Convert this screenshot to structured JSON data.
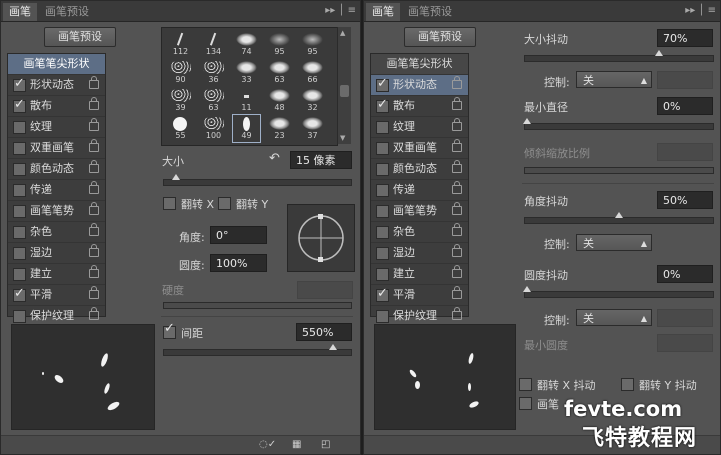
{
  "left": {
    "tabs": [
      "画笔",
      "画笔预设"
    ],
    "panel_menu_icon": "double-chevron-menu",
    "preset_button": "画笔预设",
    "list_header": "画笔笔尖形状",
    "items": [
      {
        "label": "形状动态",
        "checked": true
      },
      {
        "label": "散布",
        "checked": true
      },
      {
        "label": "纹理",
        "checked": false
      },
      {
        "label": "双重画笔",
        "checked": false
      },
      {
        "label": "颜色动态",
        "checked": false
      },
      {
        "label": "传递",
        "checked": false
      },
      {
        "label": "画笔笔势",
        "checked": false
      },
      {
        "label": "杂色",
        "checked": false
      },
      {
        "label": "湿边",
        "checked": false
      },
      {
        "label": "建立",
        "checked": false
      },
      {
        "label": "平滑",
        "checked": true
      },
      {
        "label": "保护纹理",
        "checked": false
      }
    ],
    "tips": [
      {
        "num": "112",
        "shape": "stroke"
      },
      {
        "num": "134",
        "shape": "stroke"
      },
      {
        "num": "74",
        "shape": "splat"
      },
      {
        "num": "95",
        "shape": "soft"
      },
      {
        "num": "95",
        "shape": "soft"
      },
      {
        "num": "90",
        "shape": "grain"
      },
      {
        "num": "36",
        "shape": "grain"
      },
      {
        "num": "33",
        "shape": "splat"
      },
      {
        "num": "63",
        "shape": "splat"
      },
      {
        "num": "66",
        "shape": "splat"
      },
      {
        "num": "39",
        "shape": "grain"
      },
      {
        "num": "63",
        "shape": "grain"
      },
      {
        "num": "11",
        "shape": "dash"
      },
      {
        "num": "48",
        "shape": "splat"
      },
      {
        "num": "32",
        "shape": "splat"
      },
      {
        "num": "55",
        "shape": "circle"
      },
      {
        "num": "100",
        "shape": "grain"
      },
      {
        "num": "49",
        "shape": "ellipse"
      },
      {
        "num": "23",
        "shape": "splat"
      },
      {
        "num": "37",
        "shape": "splat"
      }
    ],
    "size_label": "大小",
    "size_value": "15 像素",
    "flip_x": "翻转 X",
    "flip_y": "翻转 Y",
    "angle_label": "角度:",
    "angle_value": "0°",
    "roundness_label": "圆度:",
    "roundness_value": "100%",
    "hardness_label": "硬度",
    "spacing_label": "间距",
    "spacing_value": "550%",
    "spacing_checked": true
  },
  "right": {
    "tabs": [
      "画笔",
      "画笔预设"
    ],
    "preset_button": "画笔预设",
    "list_header": "画笔笔尖形状",
    "items": [
      {
        "label": "形状动态",
        "checked": true
      },
      {
        "label": "散布",
        "checked": true
      },
      {
        "label": "纹理",
        "checked": false
      },
      {
        "label": "双重画笔",
        "checked": false
      },
      {
        "label": "颜色动态",
        "checked": false
      },
      {
        "label": "传递",
        "checked": false
      },
      {
        "label": "画笔笔势",
        "checked": false
      },
      {
        "label": "杂色",
        "checked": false
      },
      {
        "label": "湿边",
        "checked": false
      },
      {
        "label": "建立",
        "checked": false
      },
      {
        "label": "平滑",
        "checked": true
      },
      {
        "label": "保护纹理",
        "checked": false
      }
    ],
    "size_jitter_label": "大小抖动",
    "size_jitter_value": "70%",
    "control_label": "控制:",
    "control_value": "关",
    "min_diameter_label": "最小直径",
    "min_diameter_value": "0%",
    "tilt_scale_label": "倾斜缩放比例",
    "angle_jitter_label": "角度抖动",
    "angle_jitter_value": "50%",
    "roundness_jitter_label": "圆度抖动",
    "roundness_jitter_value": "0%",
    "min_roundness_label": "最小圆度",
    "flip_x_jitter": "翻转 X 抖动",
    "flip_y_jitter": "翻转 Y 抖动",
    "brush_projection": "画笔"
  },
  "watermark": {
    "line1": "fevte.com",
    "line2": "飞特教程网"
  },
  "colors": {
    "panel": "#535353",
    "header_selected": "#5d6e86",
    "field": "#2b2b2b"
  }
}
